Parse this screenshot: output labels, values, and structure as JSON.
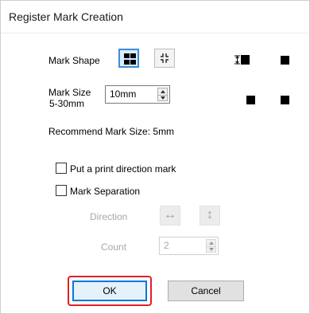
{
  "dialog": {
    "title": "Register Mark Creation",
    "mark_shape_label": "Mark Shape",
    "mark_size_label_line1": "Mark Size",
    "mark_size_label_line2": "5-30mm",
    "mark_size_value": "10mm",
    "recommend_label": "Recommend Mark Size:",
    "recommend_value": "5mm",
    "print_direction_label": "Put a print direction mark",
    "print_direction_checked": false,
    "separation_label": "Mark Separation",
    "separation_checked": false,
    "direction_label": "Direction",
    "count_label": "Count",
    "count_value": "2",
    "ok_label": "OK",
    "cancel_label": "Cancel"
  },
  "colors": {
    "highlight_ring": "#e0202a",
    "selected_accent": "#3a8fd6",
    "default_button_border": "#0078d7"
  },
  "icons": {
    "shape_option_1": "four-squares-icon",
    "shape_option_2": "corner-brackets-icon",
    "direction_horizontal": "left-right-arrow-icon",
    "direction_vertical": "up-down-arrow-icon",
    "preview_direction": "print-direction-mark-icon"
  }
}
